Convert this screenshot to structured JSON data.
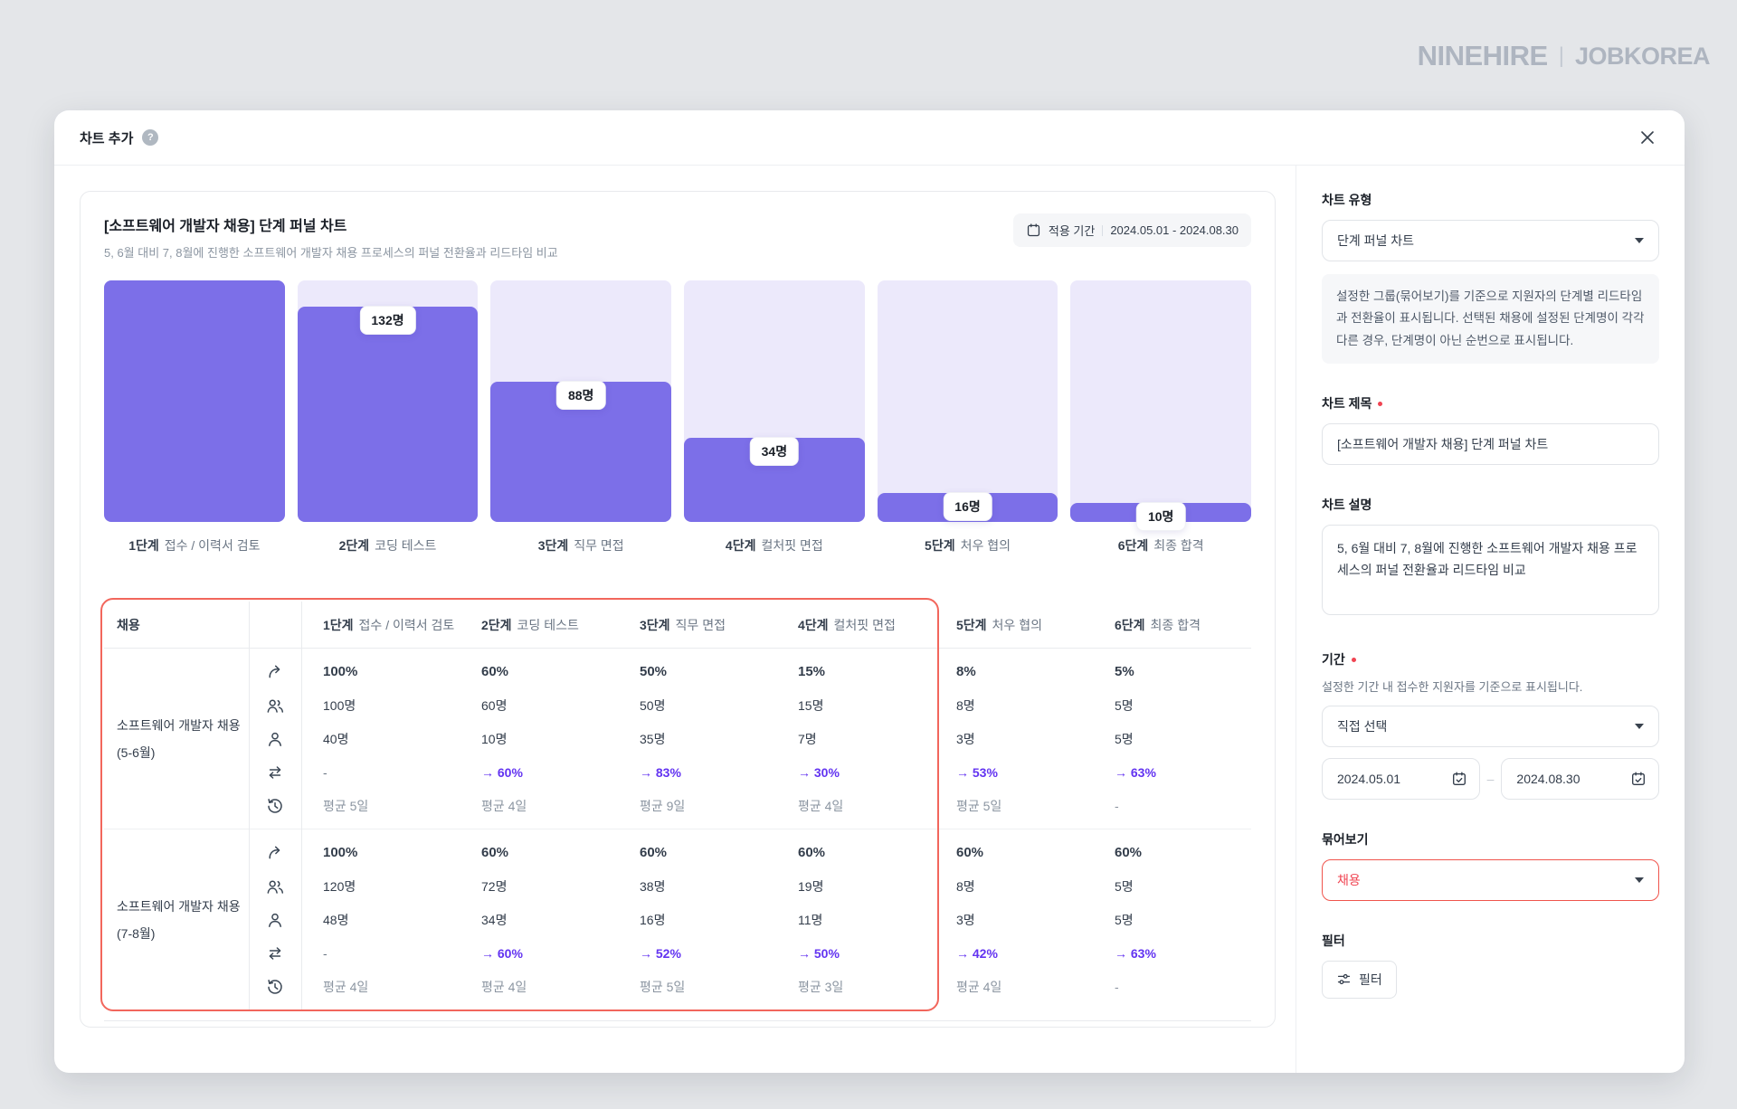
{
  "logo": {
    "brand": "NINEHIRE",
    "divider": "|",
    "partner": "JOBKOREA"
  },
  "modal": {
    "title": "차트 추가"
  },
  "chart_panel": {
    "title": "[소프트웨어 개발자 채용] 단계 퍼널 차트",
    "subtitle": "5, 6월 대비 7, 8월에 진행한 소프트웨어 개발자 채용 프로세스의 퍼널 전환율과 리드타임 비교",
    "period_badge": {
      "label": "적용 기간",
      "value": "2024.05.01 - 2024.08.30"
    }
  },
  "chart_data": {
    "type": "bar",
    "subtype": "stage-funnel",
    "title": "[소프트웨어 개발자 채용] 단계 퍼널 차트",
    "categories": [
      {
        "num": "1단계",
        "name": "접수 / 이력서 검토"
      },
      {
        "num": "2단계",
        "name": "코딩 테스트"
      },
      {
        "num": "3단계",
        "name": "직무 면접"
      },
      {
        "num": "4단계",
        "name": "컬처핏 면접"
      },
      {
        "num": "5단계",
        "name": "처우 협의"
      },
      {
        "num": "6단계",
        "name": "최종 합격"
      }
    ],
    "values": [
      null,
      132,
      88,
      34,
      16,
      10
    ],
    "value_labels": [
      "",
      "132명",
      "88명",
      "34명",
      "16명",
      "10명"
    ],
    "bar_height_pct": [
      100,
      89,
      58,
      35,
      12,
      8
    ],
    "colors": {
      "fill": "#7C6FE8",
      "track": "#ECE9FB"
    },
    "legend": "none",
    "grid": "off"
  },
  "table": {
    "group_col_header": "채용",
    "row_icons": [
      "conversion-arrow",
      "people",
      "person",
      "transfer-arrows",
      "history-clock"
    ],
    "groups": [
      {
        "label": "소프트웨어 개발자 채용 (5-6월)",
        "rows": [
          [
            "100%",
            "60%",
            "50%",
            "15%",
            "8%",
            "5%"
          ],
          [
            "100명",
            "60명",
            "50명",
            "15명",
            "8명",
            "5명"
          ],
          [
            "40명",
            "10명",
            "35명",
            "7명",
            "3명",
            "5명"
          ],
          [
            "-",
            "→ 60%",
            "→ 83%",
            "→ 30%",
            "→ 53%",
            "→ 63%"
          ],
          [
            "평균 5일",
            "평균 4일",
            "평균 9일",
            "평균 4일",
            "평균 5일",
            "-"
          ]
        ]
      },
      {
        "label": "소프트웨어 개발자 채용 (7-8월)",
        "rows": [
          [
            "100%",
            "60%",
            "60%",
            "60%",
            "60%",
            "60%"
          ],
          [
            "120명",
            "72명",
            "38명",
            "19명",
            "8명",
            "5명"
          ],
          [
            "48명",
            "34명",
            "16명",
            "11명",
            "3명",
            "5명"
          ],
          [
            "-",
            "→ 60%",
            "→ 52%",
            "→ 50%",
            "→ 42%",
            "→ 63%"
          ],
          [
            "평균 4일",
            "평균 4일",
            "평균 5일",
            "평균 3일",
            "평균 4일",
            "-"
          ]
        ]
      }
    ],
    "highlight_color": "#F2665C"
  },
  "sidebar": {
    "chart_type": {
      "label": "차트 유형",
      "value": "단계 퍼널 차트",
      "description": "설정한 그룹(묶어보기)를 기준으로 지원자의 단계별 리드타임과 전환율이 표시됩니다. 선택된 채용에 설정된 단계명이 각각 다른 경우, 단계명이 아닌 순번으로 표시됩니다."
    },
    "chart_title": {
      "label": "차트 제목",
      "value": "[소프트웨어 개발자 채용] 단계 퍼널 차트"
    },
    "chart_desc": {
      "label": "차트 설명",
      "value": "5, 6월 대비 7, 8월에 진행한 소프트웨어 개발자 채용 프로세스의 퍼널 전환율과 리드타임 비교"
    },
    "period": {
      "label": "기간",
      "helper": "설정한 기간 내 접수한 지원자를 기준으로 표시됩니다.",
      "select_value": "직접 선택",
      "start": "2024.05.01",
      "end": "2024.08.30",
      "range_dash": "–"
    },
    "group_by": {
      "label": "묶어보기",
      "value": "채용"
    },
    "filter": {
      "label": "필터",
      "button_label": "필터"
    }
  },
  "colors": {
    "accent_purple": "#7C6FE8",
    "accent_violet_text": "#6334F1",
    "alert_red": "#F04452",
    "highlight_red": "#F2665C"
  }
}
